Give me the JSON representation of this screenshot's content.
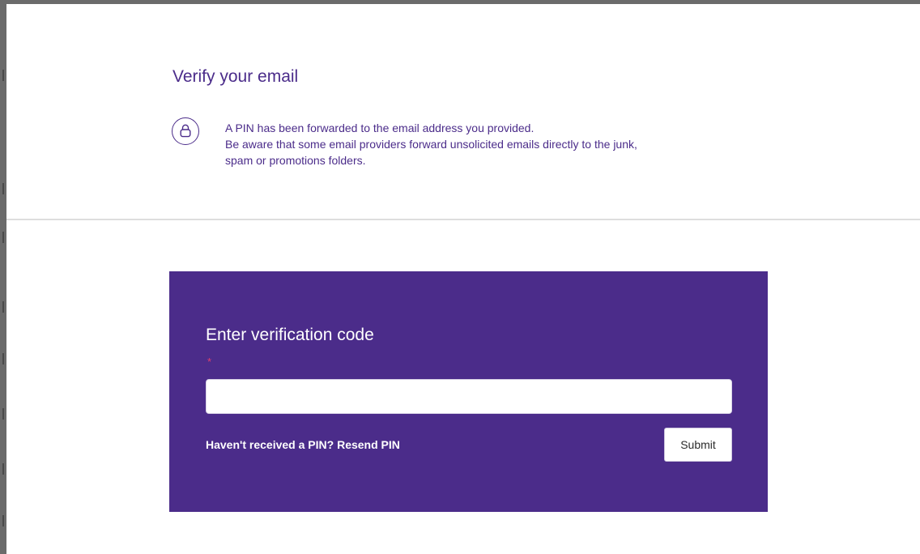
{
  "header": {
    "title": "Verify your email",
    "icon": "lock-icon",
    "info_line_1": "A PIN has been forwarded to the email address you provided.",
    "info_line_2": "Be aware that some email providers forward unsolicited emails directly to the junk,",
    "info_line_3": "spam or promotions folders."
  },
  "verify_form": {
    "title": "Enter verification code",
    "required_marker": "*",
    "code_input": {
      "value": "",
      "placeholder": ""
    },
    "resend_prompt": "Haven't received a PIN?",
    "resend_link": "Resend PIN",
    "submit_label": "Submit"
  },
  "colors": {
    "brand_purple": "#4b2c8a",
    "required_red": "#e0406e",
    "frame_gray": "#6b6b6b",
    "divider_gray": "#dedede"
  }
}
